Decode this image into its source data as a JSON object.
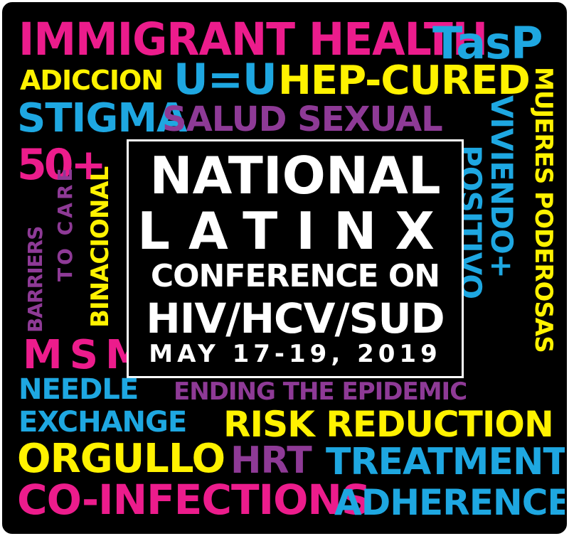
{
  "colors": {
    "magenta": "#ec1c8c",
    "cyan": "#1ea7e1",
    "yellow": "#fff200",
    "purple": "#8e3a96",
    "white": "#ffffff",
    "background": "#000000"
  },
  "center": {
    "line1": "NATIONAL",
    "line2": "LATINX",
    "line3": "CONFERENCE ON",
    "line4": "HIV/HCV/SUD",
    "line5": "MAY 17-19, 2019"
  },
  "words": {
    "immigrant_health": "IMMIGRANT HEALTH",
    "tasp": "TasP",
    "adiccion": "ADICCION",
    "u_u": "U=U",
    "hep_cured": "HEP-CURED",
    "mujeres_poderosas": "MUJERES PODEROSAS",
    "stigma": "STIGMA",
    "salud_sexual": "SALUD SEXUAL",
    "viviendo": "VIVIENDO+",
    "positivo": "POSITIVO",
    "fifty_plus": "50+",
    "barriers": "BARRIERS",
    "to_care": "TO CARE",
    "binacional": "BINACIONAL",
    "msm": "MSM",
    "needle": "NEEDLE",
    "ending_epidemic": "ENDING THE EPIDEMIC",
    "exchange": "EXCHANGE",
    "risk_reduction": "RISK REDUCTION",
    "orgullo": "ORGULLO",
    "hrt": "HRT",
    "treatment": "TREATMENT",
    "co_infections": "CO-INFECTIONS",
    "adherence": "ADHERENCE"
  }
}
